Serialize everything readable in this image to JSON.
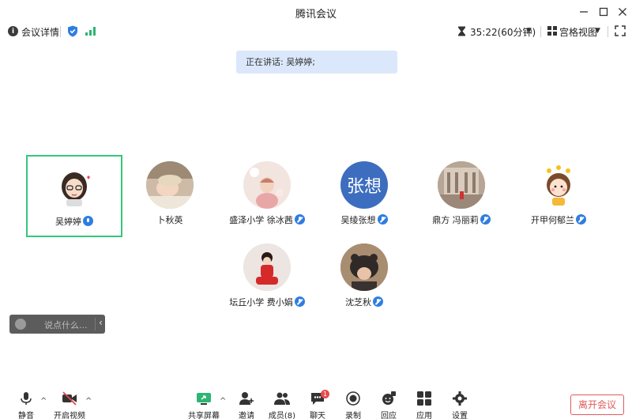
{
  "window": {
    "title": "腾讯会议"
  },
  "topbar": {
    "meeting_detail": "会议详情",
    "timer": "35:22(60分钟)",
    "view_mode": "宫格视图"
  },
  "banner": {
    "speaking": "正在讲话: 吴婷婷;"
  },
  "participants": [
    {
      "name": "吴婷婷"
    },
    {
      "name": "卜秋英"
    },
    {
      "name": "盛泽小学 徐冰茜"
    },
    {
      "name": "吴绫张想",
      "avatar_text": "张想"
    },
    {
      "name": "鼎方 冯丽莉"
    },
    {
      "name": "开甲何郁兰"
    },
    {
      "name": "坛丘小学 费小娟"
    },
    {
      "name": "沈芝秋"
    }
  ],
  "chat": {
    "placeholder": "说点什么..."
  },
  "controls": {
    "mute": "静音",
    "video": "开启视频",
    "share": "共享屏幕",
    "invite": "邀请",
    "members": "成员(8)",
    "chat": "聊天",
    "chat_badge": "1",
    "record": "录制",
    "reaction": "回应",
    "apps": "应用",
    "settings": "设置",
    "leave": "离开会议"
  },
  "colors": {
    "accent_blue": "#2f7de1",
    "active_border": "#35c77a",
    "leave_red": "#e05a5a",
    "banner_bg": "#dbe8fb"
  }
}
